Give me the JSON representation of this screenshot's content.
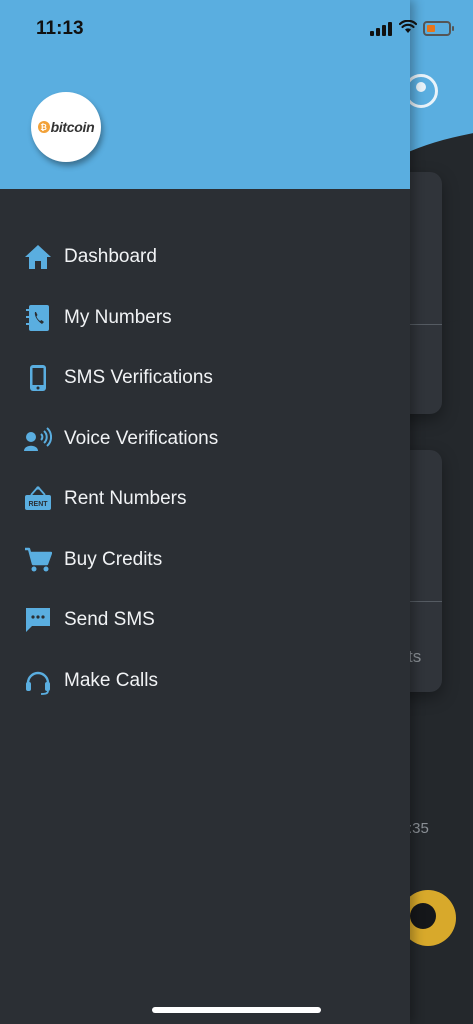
{
  "status_bar": {
    "time": "11:13"
  },
  "drawer": {
    "logo_text": "bitcoin",
    "logo_coin": "₿",
    "menu": [
      {
        "label": "Dashboard",
        "icon": "home-icon"
      },
      {
        "label": "My Numbers",
        "icon": "phonebook-icon"
      },
      {
        "label": "SMS Verifications",
        "icon": "mobile-phone-icon"
      },
      {
        "label": "Voice Verifications",
        "icon": "voice-icon"
      },
      {
        "label": "Rent Numbers",
        "icon": "rent-sign-icon"
      },
      {
        "label": "Buy Credits",
        "icon": "cart-icon"
      },
      {
        "label": "Send SMS",
        "icon": "chat-bubble-icon"
      },
      {
        "label": "Make Calls",
        "icon": "headset-icon"
      }
    ]
  },
  "background": {
    "card2_fragment": "ts",
    "time_fragment": ":35"
  },
  "colors": {
    "header_blue": "#5aaee0",
    "drawer_bg": "#2b2f34",
    "icon_blue": "#5aaee0",
    "fab_yellow": "#d8a92b"
  }
}
